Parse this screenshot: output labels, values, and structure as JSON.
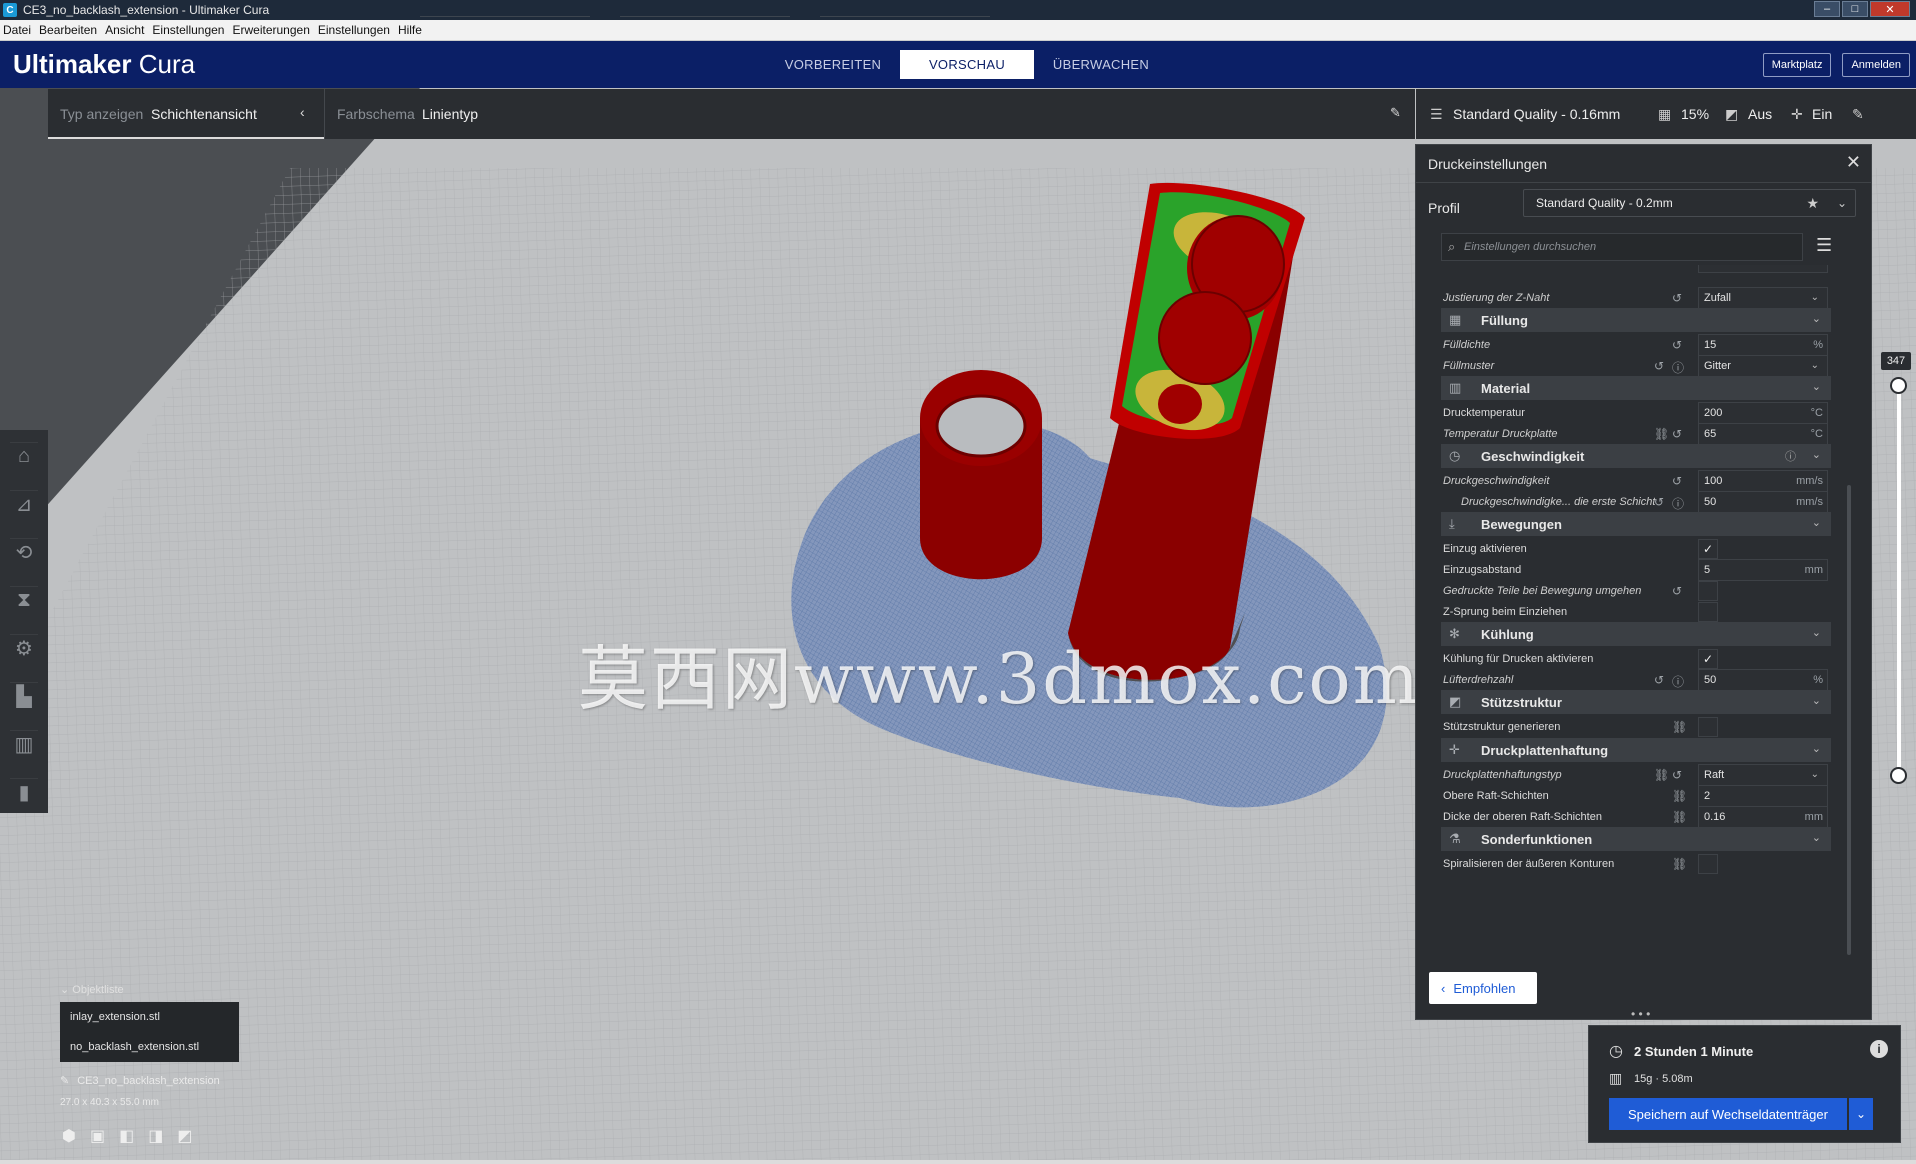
{
  "window": {
    "title": "CE3_no_backlash_extension - Ultimaker Cura"
  },
  "menu": [
    "Datei",
    "Bearbeiten",
    "Ansicht",
    "Einstellungen",
    "Erweiterungen",
    "Einstellungen",
    "Hilfe"
  ],
  "header": {
    "logo_bold": "Ultimaker",
    "logo_light": " Cura",
    "tabs": [
      "VORBEREITEN",
      "VORSCHAU",
      "ÜBERWACHEN"
    ],
    "marketplace": "Marktplatz",
    "login": "Anmelden"
  },
  "viewbar": {
    "type_label": "Typ anzeigen",
    "type_value": "Schichtenansicht",
    "scheme_label": "Farbschema",
    "scheme_value": "Linientyp"
  },
  "quality": {
    "profile": "Standard Quality - 0.16mm",
    "infill": "15%",
    "support": "Aus",
    "adhesion": "Ein"
  },
  "settings": {
    "title": "Druckeinstellungen",
    "profile_label": "Profil",
    "profile_value": "Standard Quality - 0.2mm",
    "search_placeholder": "Einstellungen durchsuchen",
    "rows": {
      "znaht": {
        "label": "Justierung der Z-Naht",
        "value": "Zufall"
      },
      "cat_fill": "Füllung",
      "dichte": {
        "label": "Fülldichte",
        "value": "15",
        "unit": "%"
      },
      "muster": {
        "label": "Füllmuster",
        "value": "Gitter"
      },
      "cat_material": "Material",
      "drucktemp": {
        "label": "Drucktemperatur",
        "value": "200",
        "unit": "°C"
      },
      "platte": {
        "label": "Temperatur Druckplatte",
        "value": "65",
        "unit": "°C"
      },
      "cat_speed": "Geschwindigkeit",
      "speed": {
        "label": "Druckgeschwindigkeit",
        "value": "100",
        "unit": "mm/s"
      },
      "speed1": {
        "label": "Druckgeschwindigke... die erste Schicht",
        "value": "50",
        "unit": "mm/s"
      },
      "cat_travel": "Bewegungen",
      "einzug": {
        "label": "Einzug aktivieren"
      },
      "einzugabstand": {
        "label": "Einzugsabstand",
        "value": "5",
        "unit": "mm"
      },
      "umgehen": {
        "label": "Gedruckte Teile bei Bewegung umgehen"
      },
      "zsprung": {
        "label": "Z-Sprung beim Einziehen"
      },
      "cat_cool": "Kühlung",
      "kuehlung": {
        "label": "Kühlung für Drucken aktivieren"
      },
      "luefter": {
        "label": "Lüfterdrehzahl",
        "value": "50",
        "unit": "%"
      },
      "cat_support": "Stützstruktur",
      "stuetz": {
        "label": "Stützstruktur generieren"
      },
      "cat_adhesion": "Druckplattenhaftung",
      "haftung": {
        "label": "Druckplattenhaftungstyp",
        "value": "Raft"
      },
      "raftschichten": {
        "label": "Obere Raft-Schichten",
        "value": "2"
      },
      "raftdicke": {
        "label": "Dicke der oberen Raft-Schichten",
        "value": "0.16",
        "unit": "mm"
      },
      "cat_special": "Sonderfunktionen",
      "spiral": {
        "label": "Spiralisieren der äußeren Konturen"
      }
    },
    "recommended": "Empfohlen"
  },
  "layer": {
    "value": "347"
  },
  "objects": {
    "title": "Objektliste",
    "items": [
      "inlay_extension.stl",
      "no_backlash_extension.stl"
    ],
    "job": "CE3_no_backlash_extension",
    "dims": "27.0 x 40.3 x 55.0 mm"
  },
  "printinfo": {
    "time": "2 Stunden 1 Minute",
    "material": "15g · 5.08m",
    "save": "Speichern auf Wechseldatenträger"
  },
  "watermark": "莫西网www.3dmox.com"
}
